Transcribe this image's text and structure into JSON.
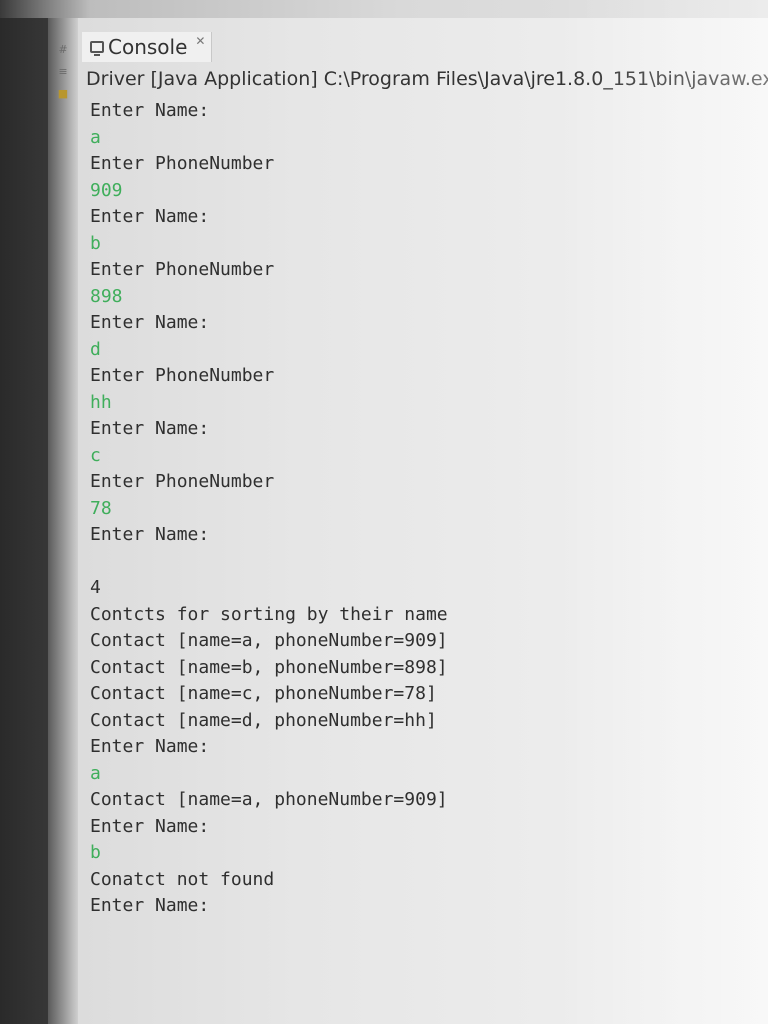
{
  "console": {
    "tab_label": "Console",
    "tab_close_glyph": "✕",
    "launch_info": "Driver [Java Application] C:\\Program Files\\Java\\jre1.8.0_151\\bin\\javaw.ex"
  },
  "output_lines": [
    {
      "kind": "sys",
      "text": "Enter Name:"
    },
    {
      "kind": "usr",
      "text": "a"
    },
    {
      "kind": "sys",
      "text": "Enter PhoneNumber"
    },
    {
      "kind": "usr",
      "text": "909"
    },
    {
      "kind": "sys",
      "text": "Enter Name:"
    },
    {
      "kind": "usr",
      "text": "b"
    },
    {
      "kind": "sys",
      "text": "Enter PhoneNumber"
    },
    {
      "kind": "usr",
      "text": "898"
    },
    {
      "kind": "sys",
      "text": "Enter Name:"
    },
    {
      "kind": "usr",
      "text": "d"
    },
    {
      "kind": "sys",
      "text": "Enter PhoneNumber"
    },
    {
      "kind": "usr",
      "text": "hh"
    },
    {
      "kind": "sys",
      "text": "Enter Name:"
    },
    {
      "kind": "usr",
      "text": "c"
    },
    {
      "kind": "sys",
      "text": "Enter PhoneNumber"
    },
    {
      "kind": "usr",
      "text": "78"
    },
    {
      "kind": "sys",
      "text": "Enter Name:"
    },
    {
      "kind": "blank",
      "text": ""
    },
    {
      "kind": "sys",
      "text": "4"
    },
    {
      "kind": "sys",
      "text": "Contcts for sorting by their name"
    },
    {
      "kind": "sys",
      "text": "Contact [name=a, phoneNumber=909]"
    },
    {
      "kind": "sys",
      "text": "Contact [name=b, phoneNumber=898]"
    },
    {
      "kind": "sys",
      "text": "Contact [name=c, phoneNumber=78]"
    },
    {
      "kind": "sys",
      "text": "Contact [name=d, phoneNumber=hh]"
    },
    {
      "kind": "sys",
      "text": "Enter Name:"
    },
    {
      "kind": "usr",
      "text": "a"
    },
    {
      "kind": "sys",
      "text": "Contact [name=a, phoneNumber=909]"
    },
    {
      "kind": "sys",
      "text": "Enter Name:"
    },
    {
      "kind": "usr",
      "text": "b"
    },
    {
      "kind": "sys",
      "text": "Conatct not found"
    },
    {
      "kind": "sys",
      "text": "Enter Name:"
    }
  ],
  "colors": {
    "system_output": "#2f2f2f",
    "user_input": "#3fae5b"
  },
  "icons": [
    "pin-icon",
    "layout-icon",
    "folder-icon",
    "console-icon",
    "close-icon"
  ]
}
